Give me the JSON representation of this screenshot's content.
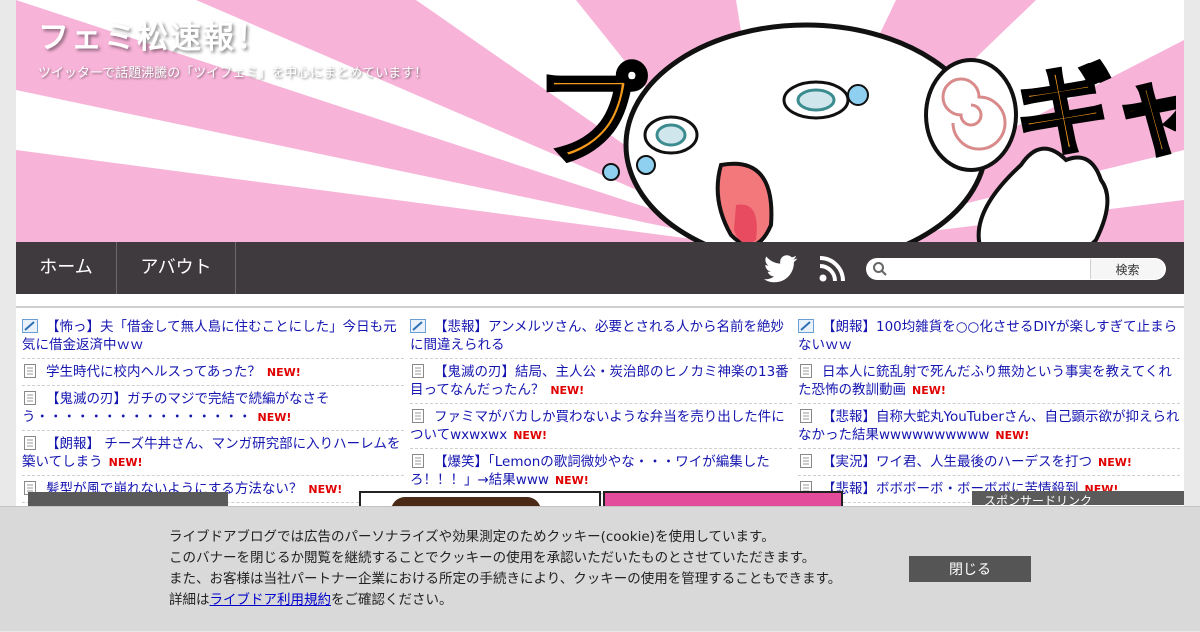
{
  "site": {
    "title": "フェミ松速報！",
    "description": "ツイッターで話題沸騰の「ツイフェミ」を中心にまとめています！",
    "header_colors": {
      "ray_pink": "#f7b3d8",
      "nav_bg": "#3f3a3d"
    },
    "mascot_text_left": "プ",
    "mascot_text_right": "ギャ"
  },
  "nav": {
    "home": "ホーム",
    "about": "アバウト",
    "twitter_icon": "twitter-icon",
    "rss_icon": "rss-icon",
    "search_button": "検索",
    "search_placeholder": ""
  },
  "columns": [
    [
      {
        "icon": "pencil-icon",
        "text": "【怖っ】夫「借金して無人島に住むことにした」今日も元気に借金返済中ｗｗ",
        "new": ""
      },
      {
        "icon": "document-icon",
        "text": "学生時代に校内ヘルスってあった？",
        "new": "NEW!"
      },
      {
        "icon": "document-icon",
        "text": "【鬼滅の刃】ガチのマジで完結で続編がなさそう・・・・・・・・・・・・・・・・",
        "new": "NEW!"
      },
      {
        "icon": "document-icon",
        "text": "【朗報】 チーズ牛丼さん、マンガ研究部に入りハーレムを築いてしまう",
        "new": "NEW!"
      },
      {
        "icon": "document-icon",
        "text": "髪型が風で崩れないようにする方法ない？",
        "new": "NEW!"
      }
    ],
    [
      {
        "icon": "pencil-icon",
        "text": "【悲報】アンメルツさん、必要とされる人から名前を絶妙に間違えられる",
        "new": ""
      },
      {
        "icon": "document-icon",
        "text": "【鬼滅の刃】結局、主人公・炭治郎のヒノカミ神楽の13番目ってなんだったん？",
        "new": "NEW!"
      },
      {
        "icon": "document-icon",
        "text": "ファミマがバカしか買わないような弁当を売り出した件についてwxwxwx",
        "new": "NEW!"
      },
      {
        "icon": "document-icon",
        "text": "【爆笑】「Lemonの歌詞微妙やな・・・ワイが編集したろ！！！」→結果www",
        "new": "NEW!"
      }
    ],
    [
      {
        "icon": "pencil-icon",
        "text": "【朗報】100均雑貨を○○化させるDIYが楽しすぎて止まらないｗｗ",
        "new": ""
      },
      {
        "icon": "document-icon",
        "text": "日本人に銃乱射で死んだふり無効という事実を教えてくれた恐怖の教訓動画",
        "new": "NEW!"
      },
      {
        "icon": "document-icon",
        "text": "【悲報】自称大蛇丸YouTuberさん、自己顕示欲が抑えられなかった結果wwwwwwwwww",
        "new": "NEW!"
      },
      {
        "icon": "document-icon",
        "text": "【実況】ワイ君、人生最後のハーデスを打つ",
        "new": "NEW!"
      },
      {
        "icon": "document-icon",
        "text": "【悲報】ボボボーボ・ボーボボに苦情殺到",
        "new": "NEW!"
      }
    ]
  ],
  "sponsor_label": "スポンサードリンク",
  "cookie": {
    "line1": "ライブドアブログでは広告のパーソナライズや効果測定のためクッキー(cookie)を使用しています。",
    "line2": "このバナーを閉じるか閲覧を継続することでクッキーの使用を承認いただいたものとさせていただきます。",
    "line3": "また、お客様は当社パートナー企業における所定の手続きにより、クッキーの使用を管理することもできます。",
    "line4_prefix": "詳細は",
    "link": "ライブドア利用規約",
    "line4_suffix": "をご確認ください。",
    "close": "閉じる"
  }
}
